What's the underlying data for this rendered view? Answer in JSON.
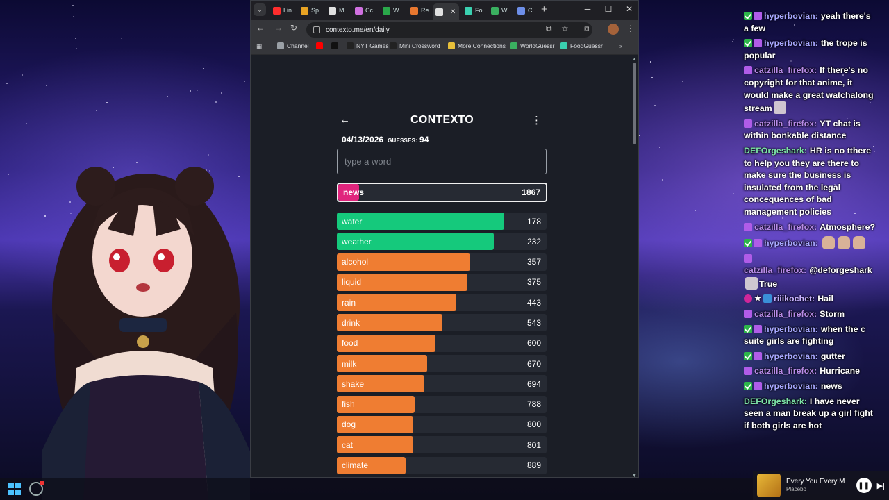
{
  "browser": {
    "tabs": [
      {
        "label": "Lin",
        "color": "#ff2d2d"
      },
      {
        "label": "Sp",
        "color": "#e8a323"
      },
      {
        "label": "M",
        "color": "#e0e0e0"
      },
      {
        "label": "Cc",
        "color": "#d070e0"
      },
      {
        "label": "W",
        "color": "#2aa84a"
      },
      {
        "label": "Re",
        "color": "#e8772f"
      },
      {
        "label": "",
        "color": "#e0e0e0"
      },
      {
        "label": "Fo",
        "color": "#3ad0b0"
      },
      {
        "label": "W",
        "color": "#3ab060"
      },
      {
        "label": "Ci",
        "color": "#6d8ee8"
      }
    ],
    "active_tab_close": "✕",
    "url": "contexto.me/en/daily",
    "bookmarks": [
      {
        "label": "Channel",
        "icon": "folder-icon",
        "color": "#9aa0a6"
      },
      {
        "label": "",
        "icon": "youtube-icon",
        "color": "#ff0000"
      },
      {
        "label": "",
        "icon": "x-icon",
        "color": "#111111"
      },
      {
        "label": "NYT Games",
        "icon": "nyt-icon",
        "color": "#222222"
      },
      {
        "label": "Mini Crossword",
        "icon": "crossword-icon",
        "color": "#222222"
      },
      {
        "label": "More Connections",
        "icon": "grid-icon",
        "color": "#e8c03a"
      },
      {
        "label": "WorldGuessr",
        "icon": "globe-icon",
        "color": "#3ab060"
      },
      {
        "label": "FoodGuessr",
        "icon": "food-icon",
        "color": "#3ad0b0"
      }
    ]
  },
  "contexto": {
    "title": "CONTEXTO",
    "date": "04/13/2026",
    "guesses_label": "GUESSES:",
    "guesses_count": "94",
    "input_placeholder": "type a word",
    "last_guess": {
      "word": "news",
      "rank": 1867,
      "fill": 0.1,
      "color": "#e0257d"
    },
    "guesses": [
      {
        "word": "water",
        "rank": 178,
        "fill": 0.797,
        "color": "#15c97c"
      },
      {
        "word": "weather",
        "rank": 232,
        "fill": 0.747,
        "color": "#15c97c"
      },
      {
        "word": "alcohol",
        "rank": 357,
        "fill": 0.637,
        "color": "#ef7d32"
      },
      {
        "word": "liquid",
        "rank": 375,
        "fill": 0.623,
        "color": "#ef7d32"
      },
      {
        "word": "rain",
        "rank": 443,
        "fill": 0.57,
        "color": "#ef7d32"
      },
      {
        "word": "drink",
        "rank": 543,
        "fill": 0.503,
        "color": "#ef7d32"
      },
      {
        "word": "food",
        "rank": 600,
        "fill": 0.47,
        "color": "#ef7d32"
      },
      {
        "word": "milk",
        "rank": 670,
        "fill": 0.43,
        "color": "#ef7d32"
      },
      {
        "word": "shake",
        "rank": 694,
        "fill": 0.417,
        "color": "#ef7d32"
      },
      {
        "word": "fish",
        "rank": 788,
        "fill": 0.37,
        "color": "#ef7d32"
      },
      {
        "word": "dog",
        "rank": 800,
        "fill": 0.363,
        "color": "#ef7d32"
      },
      {
        "word": "cat",
        "rank": 801,
        "fill": 0.363,
        "color": "#ef7d32"
      },
      {
        "word": "climate",
        "rank": 889,
        "fill": 0.327,
        "color": "#ef7d32"
      }
    ]
  },
  "chat": [
    {
      "user": "hyperbovian:",
      "cls": "u-hyper",
      "badges": [
        "check",
        "sub"
      ],
      "text": "yeah there's a few"
    },
    {
      "user": "hyperbovian:",
      "cls": "u-hyper",
      "badges": [
        "check",
        "sub"
      ],
      "text": "the trope is popular"
    },
    {
      "user": "catzilla_firefox:",
      "cls": "u-cat",
      "badges": [
        "sub"
      ],
      "text": "If there's no copyright for that anime, it would make a great watchalong stream",
      "emotes_after": [
        "emote"
      ]
    },
    {
      "user": "catzilla_firefox:",
      "cls": "u-cat",
      "badges": [
        "sub"
      ],
      "text": "YT chat is within bonkable distance"
    },
    {
      "user": "DEFOrgeshark:",
      "cls": "u-def",
      "badges": [],
      "text": "HR is no tthere to help you they are there to make sure the business is insulated from the legal concequences of bad management policies"
    },
    {
      "user": "catzilla_firefox:",
      "cls": "u-cat",
      "badges": [
        "sub"
      ],
      "text": "Atmosphere?"
    },
    {
      "user": "hyperbovian:",
      "cls": "u-hyper",
      "badges": [
        "check",
        "sub"
      ],
      "text": "",
      "emotes_after": [
        "hand",
        "hand",
        "hand"
      ]
    },
    {
      "user": "catzilla_firefox:",
      "cls": "u-cat",
      "badges": [
        "sub"
      ],
      "text": "@deforgeshark",
      "emotes_after": [
        "emote"
      ],
      "text2": "True"
    },
    {
      "user": "riiikochet:",
      "cls": "u-riii",
      "badges": [
        "heart",
        "star",
        "prime"
      ],
      "text": "Hail"
    },
    {
      "user": "catzilla_firefox:",
      "cls": "u-cat",
      "badges": [
        "sub"
      ],
      "text": "Storm"
    },
    {
      "user": "hyperbovian:",
      "cls": "u-hyper",
      "badges": [
        "check",
        "sub"
      ],
      "text": "when the c suite girls are fighting"
    },
    {
      "user": "hyperbovian:",
      "cls": "u-hyper",
      "badges": [
        "check",
        "sub"
      ],
      "text": "gutter"
    },
    {
      "user": "catzilla_firefox:",
      "cls": "u-cat",
      "badges": [
        "sub"
      ],
      "text": "Hurricane"
    },
    {
      "user": "hyperbovian:",
      "cls": "u-hyper",
      "badges": [
        "check",
        "sub"
      ],
      "text": "news"
    },
    {
      "user": "DEFOrgeshark:",
      "cls": "u-def",
      "badges": [],
      "text": "I have never seen a man break up a girl fight if both girls are hot"
    }
  ],
  "media": {
    "title": "Every You Every M",
    "artist": "Placebo"
  }
}
